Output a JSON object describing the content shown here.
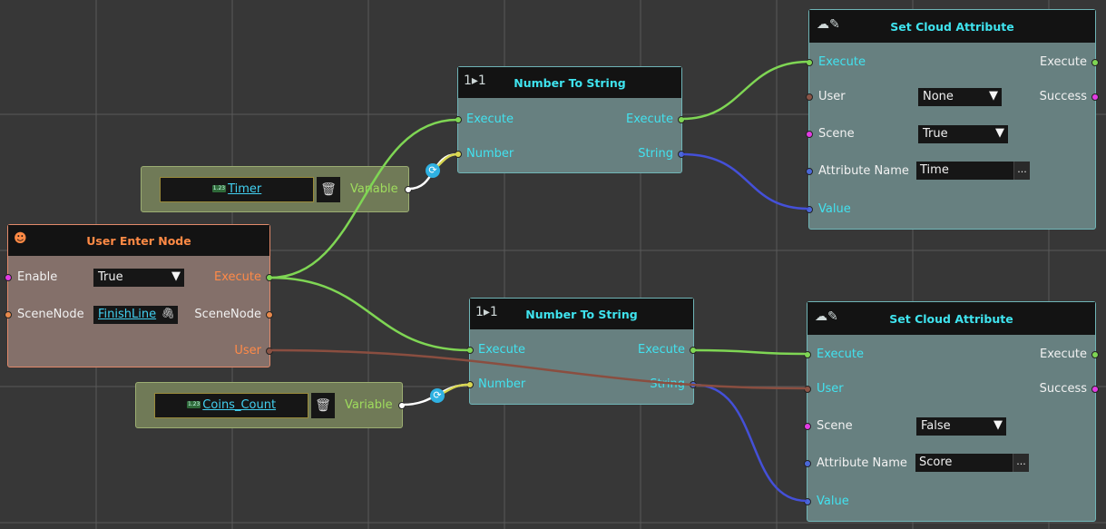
{
  "icons": {
    "number_to_string": "1▸1",
    "cloud_edit": "☁✎",
    "user_enter": "☻",
    "trash": "🗑",
    "dropdown": "▼",
    "more": "...",
    "convert": "⟳",
    "clip": "🖇",
    "variable_badge": "1.23"
  },
  "colors": {
    "execute_port": "#7fd654",
    "string_port": "#4b68d8",
    "user_port": "#8a5446",
    "bool_port": "#e33ce4",
    "teal_border": "#6fb5b7",
    "title_cyan": "#3fe3ee",
    "title_orange": "#ff8a45"
  },
  "user_enter_node": {
    "title": "User Enter Node",
    "enable_label": "Enable",
    "enable_value": "True",
    "scenenode_label": "SceneNode",
    "scenenode_value": "FinishLine",
    "execute_out": "Execute",
    "scenenode_out": "SceneNode",
    "user_out": "User"
  },
  "var_timer": {
    "name": "Timer",
    "out_label": "Variable"
  },
  "var_coins": {
    "name": "Coins_Count",
    "out_label": "Variable"
  },
  "nts_1": {
    "title": "Number To String",
    "in_execute": "Execute",
    "in_number": "Number",
    "out_execute": "Execute",
    "out_string": "String"
  },
  "nts_2": {
    "title": "Number To String",
    "in_execute": "Execute",
    "in_number": "Number",
    "out_execute": "Execute",
    "out_string": "String"
  },
  "sca_1": {
    "title": "Set Cloud Attribute",
    "in_execute": "Execute",
    "user": "User",
    "user_value": "None",
    "scene": "Scene",
    "scene_value": "True",
    "attr_name": "Attribute Name",
    "attr_value": "Time",
    "value": "Value",
    "out_execute": "Execute",
    "out_success": "Success"
  },
  "sca_2": {
    "title": "Set Cloud Attribute",
    "in_execute": "Execute",
    "user": "User",
    "scene": "Scene",
    "scene_value": "False",
    "attr_name": "Attribute Name",
    "attr_value": "Score",
    "value": "Value",
    "out_execute": "Execute",
    "out_success": "Success"
  }
}
